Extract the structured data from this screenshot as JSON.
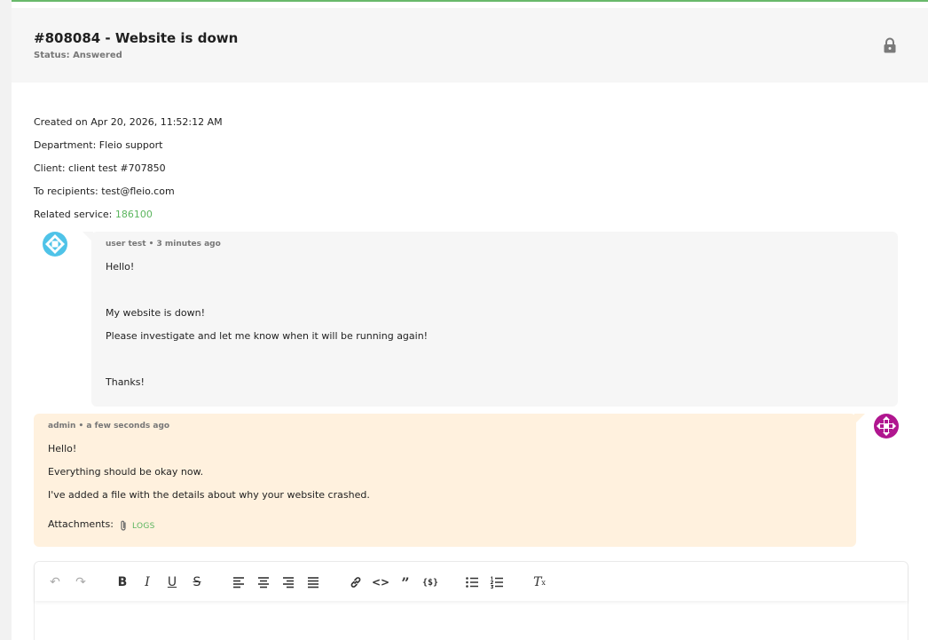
{
  "ticket": {
    "title": "#808084 - Website is down",
    "status": "Status: Answered"
  },
  "meta": {
    "created": "Created on Apr 20, 2026, 11:52:12 AM",
    "department": "Department: Fleio support",
    "client": "Client: client test #707850",
    "recipients": "To recipients: test@fleio.com",
    "related_label": "Related service: ",
    "related_value": "186100"
  },
  "messages": [
    {
      "author": "user test • 3 minutes ago",
      "lines": [
        "Hello!",
        "My website is down!",
        "Please investigate and let me know when it will be running again!",
        "Thanks!"
      ]
    },
    {
      "author": "admin • a few seconds ago",
      "lines": [
        "Hello!",
        "Everything should be okay now.",
        "I've added a file with the details about why your website crashed."
      ],
      "attachments_label": "Attachments:",
      "attachment_name": "LOGS"
    }
  ],
  "toolbar": {
    "undo": "↶",
    "redo": "↷",
    "bold": "B",
    "italic": "I",
    "underline": "U",
    "strike": "S",
    "code": "<>",
    "quote": "”",
    "variable": "{$}",
    "clear": "T"
  },
  "colors": {
    "accent": "#5bb55e",
    "admin_bg": "#fff1de",
    "user_bg": "#f6f6f6"
  }
}
